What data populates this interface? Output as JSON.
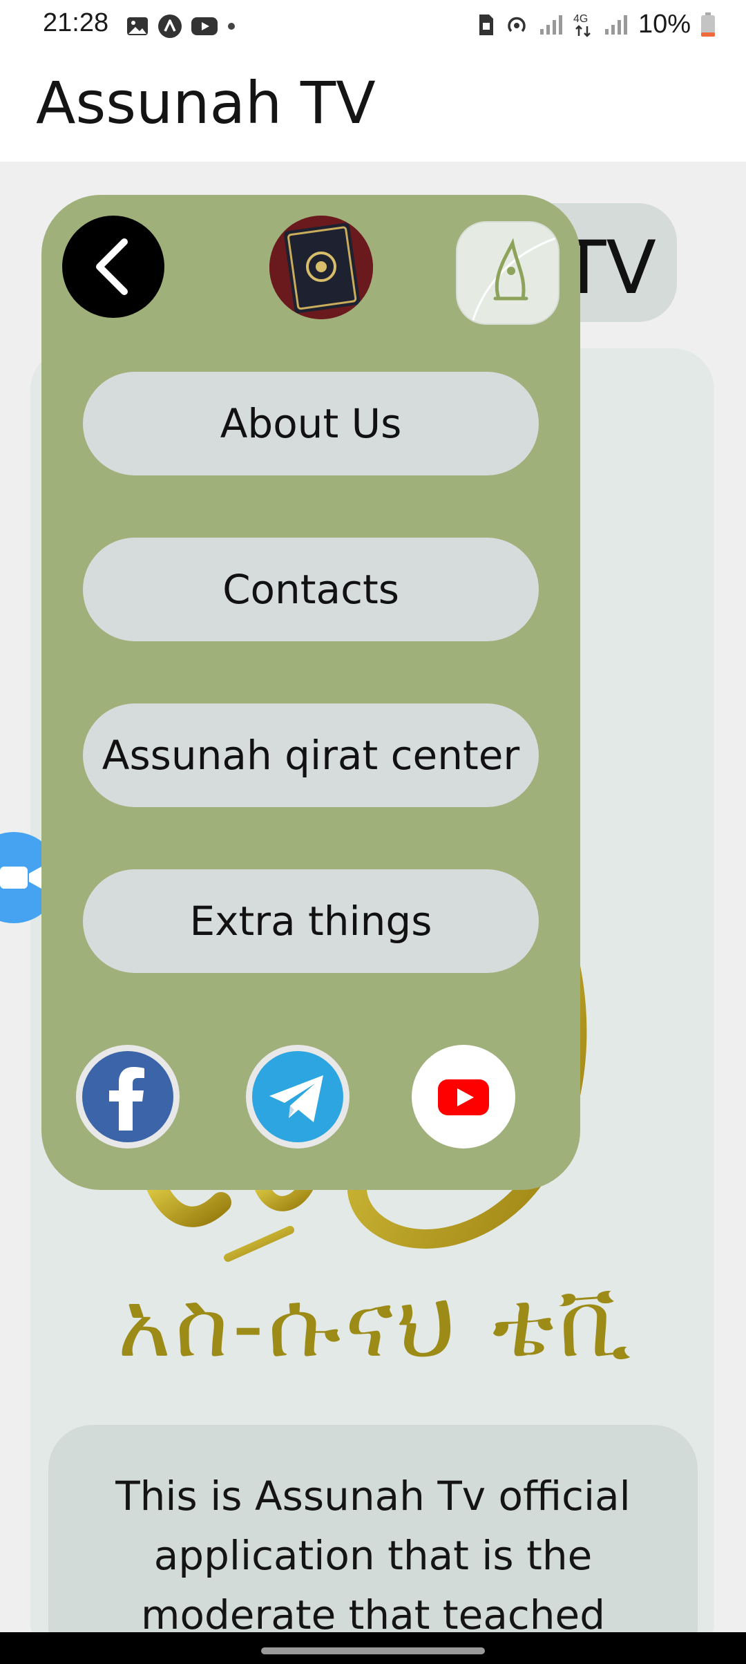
{
  "status_bar": {
    "time": "21:28",
    "battery_text": "10%",
    "network_label": "4G",
    "left_icons": [
      "image-icon",
      "arrow-app-icon",
      "youtube-notification-icon",
      "dot-icon"
    ],
    "right_icons": [
      "sim-icon",
      "hotspot-icon",
      "signal-icon",
      "4g-icon",
      "signal-icon",
      "battery-icon"
    ]
  },
  "app_bar": {
    "title": "Assunah TV"
  },
  "background": {
    "title_fragment": "TV",
    "amharic_title": "አስ-ሱናህ ቴቪ",
    "description": "This is Assunah Tv official application that is the moderate that teached"
  },
  "drawer": {
    "back_icon": "chevron-left-icon",
    "menu": {
      "about": "About Us",
      "contacts": "Contacts",
      "qirat": "Assunah qirat center",
      "extra": "Extra things"
    },
    "logo_caption": "አስ-ሱናህ ቴቪ",
    "social": [
      {
        "name": "facebook-icon",
        "color": "#3b5998"
      },
      {
        "name": "telegram-icon",
        "color": "#2ca5e0"
      },
      {
        "name": "youtube-icon",
        "color": "#ff0000"
      }
    ]
  },
  "floating_button": {
    "icon": "video-camera-icon",
    "color": "#45a3f1"
  },
  "colors": {
    "drawer_bg": "#a0b07b",
    "menu_button_bg": "#d6dcdc",
    "gold": "#b89d1a"
  }
}
